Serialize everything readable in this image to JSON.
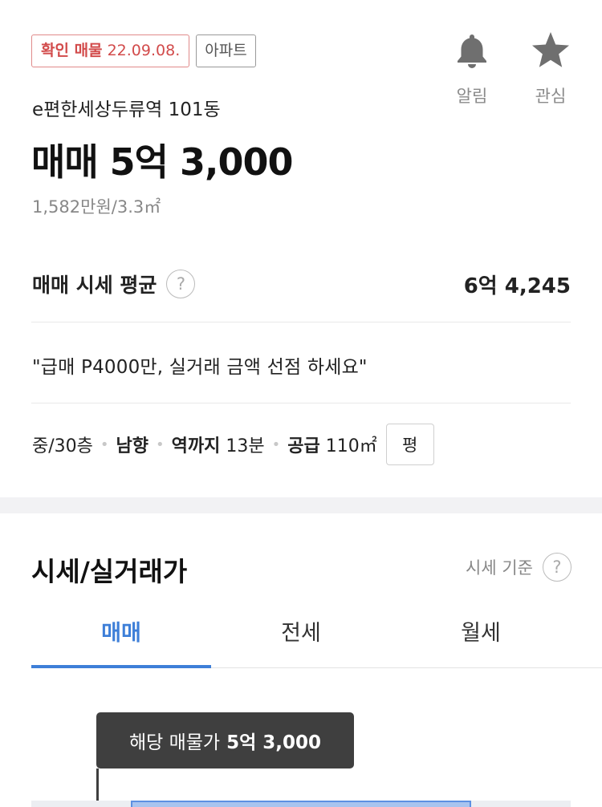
{
  "listing": {
    "confirm_label": "확인 매물",
    "confirm_date": "22.09.08.",
    "property_type": "아파트",
    "apt_name": "e편한세상두류역 101동",
    "price": "매매 5억 3,000",
    "unit_price": "1,582만원/3.3㎡"
  },
  "actions": {
    "alarm_label": "알림",
    "favorite_label": "관심"
  },
  "market_avg": {
    "label": "매매 시세 평균",
    "help_icon": "?",
    "value": "6억 4,245"
  },
  "description": "\"급매 P4000만, 실거래 금액 선점 하세요\"",
  "specs": {
    "floor": "중/30층",
    "direction": "남향",
    "station_label": "역까지",
    "station_time": "13분",
    "supply_label": "공급",
    "supply_area": "110㎡",
    "unit_toggle": "평"
  },
  "price_section": {
    "title": "시세/실거래가",
    "basis_label": "시세 기준",
    "help_icon": "?",
    "tabs": [
      "매매",
      "전세",
      "월세"
    ],
    "active_tab": "매매",
    "tooltip_label": "해당 매물가",
    "tooltip_value": "5억 3,000"
  },
  "colors": {
    "accent_blue": "#3e7fd8",
    "confirm_red": "#d24b4b",
    "icon_gray": "#6f6f6f"
  },
  "icons": {
    "alarm": "bell-icon",
    "favorite": "star-icon"
  }
}
